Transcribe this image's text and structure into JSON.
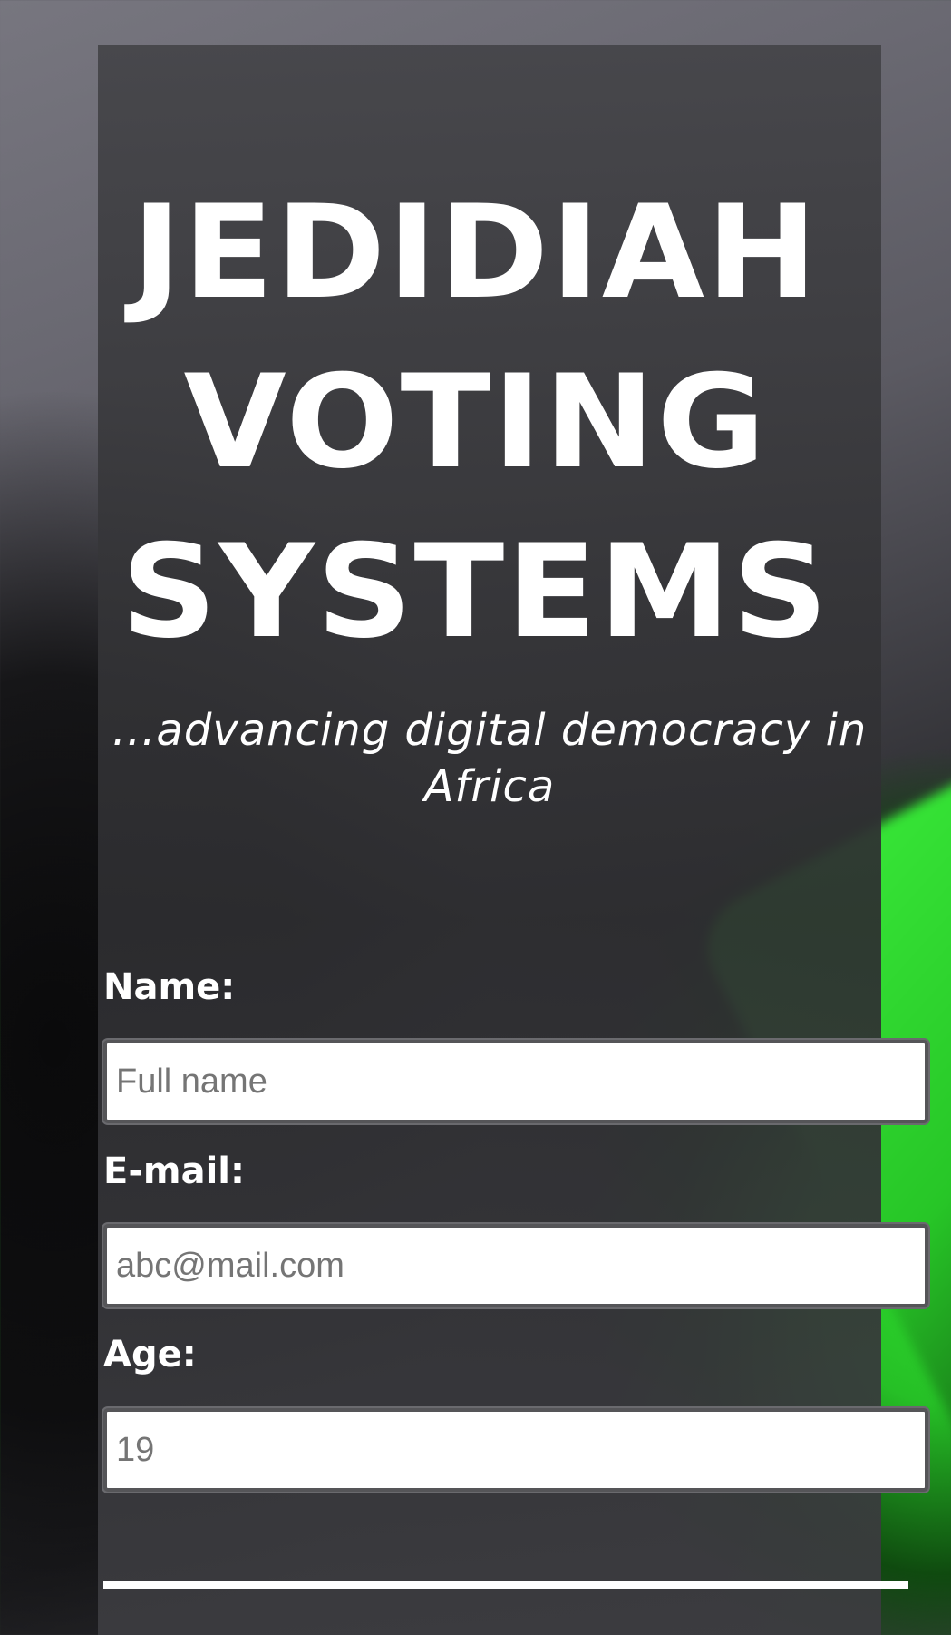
{
  "header": {
    "title_lines": [
      "JEDIDIAH",
      "VOTING",
      "SYSTEMS"
    ],
    "tagline": "...advancing digital democracy in Africa"
  },
  "form": {
    "name": {
      "label": "Name:",
      "placeholder": "Full name"
    },
    "email": {
      "label": "E-mail:",
      "placeholder": "abc@mail.com"
    },
    "age": {
      "label": "Age:",
      "placeholder": "19"
    }
  },
  "colors": {
    "card_background": "#3a3a3d",
    "text": "#ffffff",
    "accent_green": "#2fe12f"
  }
}
